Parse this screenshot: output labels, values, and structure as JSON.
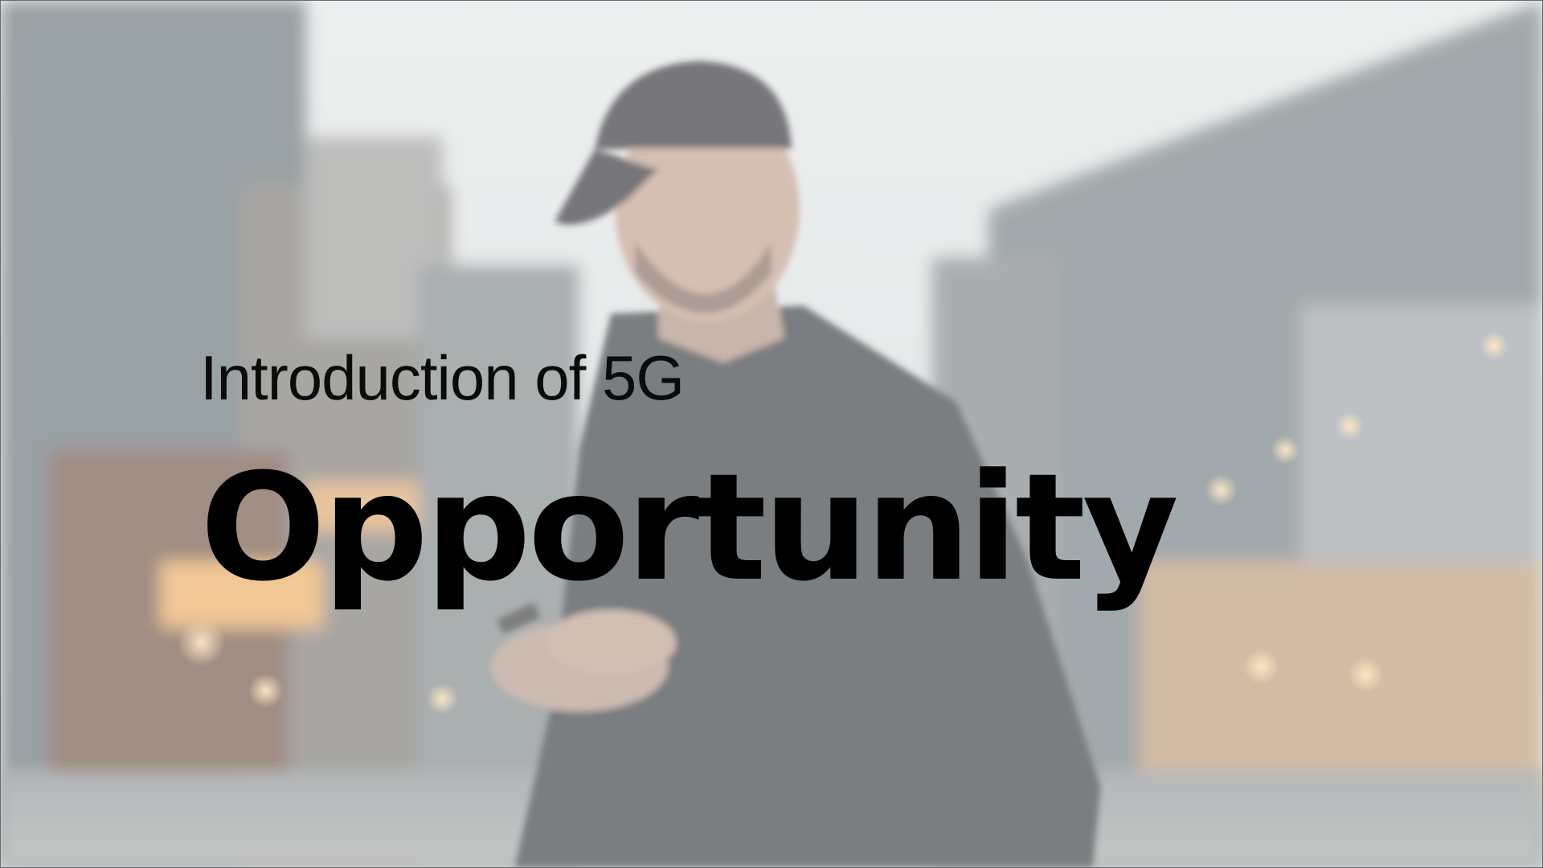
{
  "slide": {
    "subtitle_prefix": "Introduction of ",
    "subtitle_highlight": "5G",
    "headline": "Opportunity"
  },
  "background": {
    "description_icon": "street-photo-man-with-phone",
    "overlay_color": "#ffffff"
  }
}
